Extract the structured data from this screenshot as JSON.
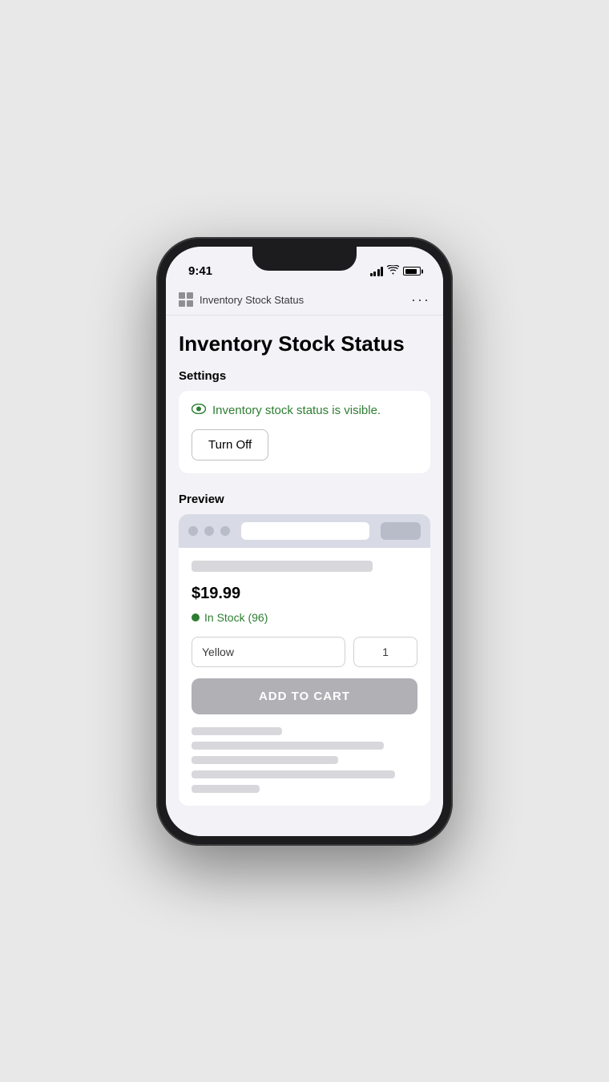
{
  "phone": {
    "status_bar": {
      "time": "9:41"
    },
    "app_header": {
      "title": "Inventory Stock Status",
      "more_icon_label": "···"
    },
    "page": {
      "title": "Inventory Stock Status",
      "settings_heading": "Settings",
      "visible_status_text": "Inventory stock status is visible.",
      "turn_off_label": "Turn Off",
      "preview_heading": "Preview",
      "price": "$19.99",
      "stock_text": "In Stock (96)",
      "variant_label": "Yellow",
      "quantity_value": "1",
      "add_to_cart_label": "ADD TO CART"
    }
  }
}
